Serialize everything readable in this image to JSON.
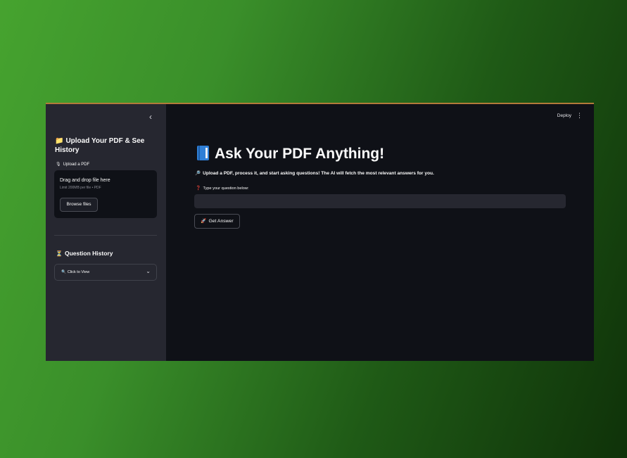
{
  "sidebar": {
    "collapse_glyph": "‹",
    "title_emoji": "📁",
    "title": "Upload Your PDF & See History",
    "upload_label_emoji": "🎙",
    "upload_label": "Upload a PDF",
    "dropzone_title": "Drag and drop file here",
    "dropzone_limit": "Limit 200MB per file • PDF",
    "browse_button": "Browse files",
    "history_emoji": "⏳",
    "history_title": "Question History",
    "expander_emoji": "🔍",
    "expander_label": "Click to View",
    "expander_chevron": "⌄"
  },
  "header": {
    "deploy": "Deploy",
    "menu_glyph": "⋮"
  },
  "main": {
    "title_icon": "book-icon",
    "title": "Ask Your PDF Anything!",
    "intro_emoji": "🔎",
    "intro": "Upload a PDF, process it, and start asking questions! The AI will fetch the most relevant answers for you.",
    "question_emoji": "❓",
    "question_label": "Type your question below:",
    "question_value": "",
    "answer_emoji": "🚀",
    "answer_button": "Get Answer"
  },
  "colors": {
    "sidebar_bg": "#262730",
    "main_bg": "#0f1117",
    "input_bg": "#262730",
    "text": "#fafafa",
    "book_blue": "#2f7fd6"
  }
}
